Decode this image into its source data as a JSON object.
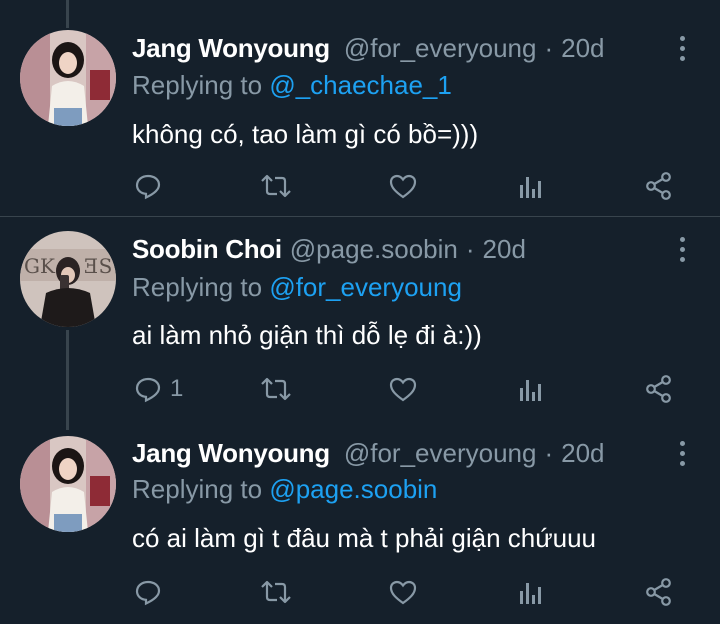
{
  "tweets": [
    {
      "name": "Jang Wonyoung",
      "handle": "@for_everyoung",
      "time": "20d",
      "replying_label": "Replying to",
      "replying_to": "@_chaechae_1",
      "text": "không có, tao làm gì có bồ=)))",
      "reply_count": ""
    },
    {
      "name": "Soobin Choi",
      "handle": "@page.soobin",
      "time": "20d",
      "replying_label": "Replying to",
      "replying_to": "@for_everyoung",
      "text": "ai làm nhỏ giận thì dỗ lẹ đi à:))",
      "reply_count": "1"
    },
    {
      "name": "Jang Wonyoung",
      "handle": "@for_everyoung",
      "time": "20d",
      "replying_label": "Replying to",
      "replying_to": "@page.soobin",
      "text": "có ai làm gì t đâu mà t phải giận chứuuu",
      "reply_count": ""
    }
  ],
  "separator": "·",
  "icons": {
    "reply": "reply-icon",
    "retweet": "retweet-icon",
    "like": "heart-icon",
    "analytics": "analytics-icon",
    "share": "share-icon",
    "more": "more-vertical-icon"
  },
  "colors": {
    "background": "#15202b",
    "secondary_text": "#8899a6",
    "accent": "#1da1f2",
    "divider": "#38444d"
  }
}
